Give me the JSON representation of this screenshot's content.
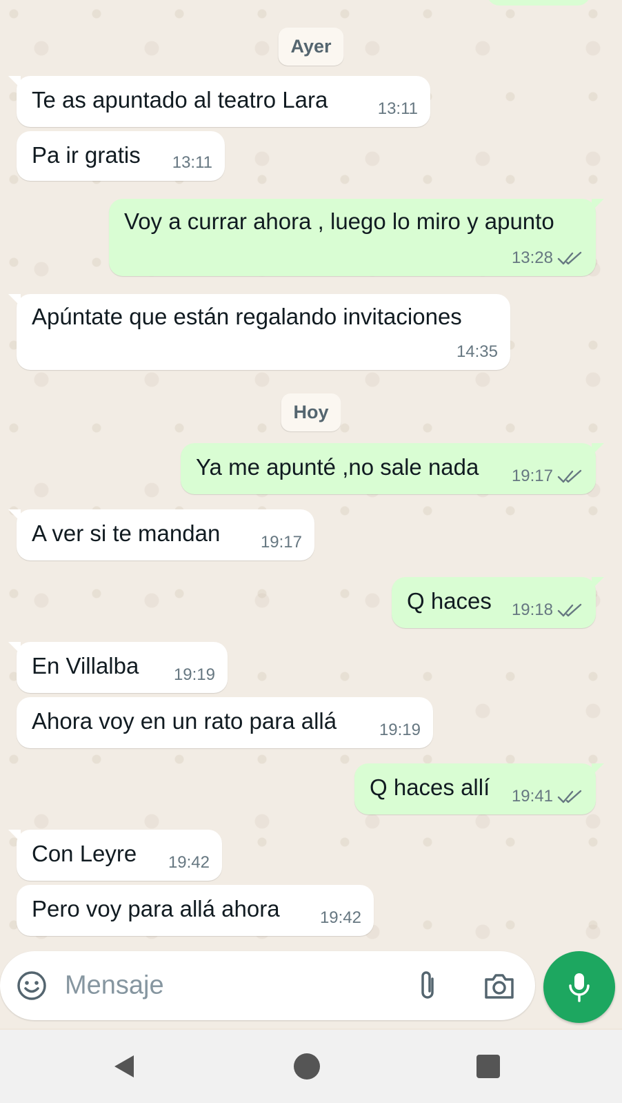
{
  "date_separators": [
    "Ayer",
    "Hoy"
  ],
  "messages": [
    {
      "dir": "in",
      "text": "Te as apuntado al teatro Lara",
      "time": "13:11"
    },
    {
      "dir": "in",
      "text": "Pa ir gratis",
      "time": "13:11"
    },
    {
      "dir": "out",
      "text": "Voy a currar ahora , luego lo miro y apunto",
      "time": "13:28",
      "status": "read"
    },
    {
      "dir": "in",
      "text": "Apúntate que están regalando invitaciones",
      "time": "14:35"
    },
    {
      "dir": "out",
      "text": "Ya me apunté ,no sale nada",
      "time": "19:17",
      "status": "read"
    },
    {
      "dir": "in",
      "text": "A ver si te mandan",
      "time": "19:17"
    },
    {
      "dir": "out",
      "text": "Q haces",
      "time": "19:18",
      "status": "read"
    },
    {
      "dir": "in",
      "text": "En Villalba",
      "time": "19:19"
    },
    {
      "dir": "in",
      "text": "Ahora voy en un rato para allá",
      "time": "19:19"
    },
    {
      "dir": "out",
      "text": "Q haces allí",
      "time": "19:41",
      "status": "read"
    },
    {
      "dir": "in",
      "text": "Con Leyre",
      "time": "19:42"
    },
    {
      "dir": "in",
      "text": "Pero voy para allá ahora",
      "time": "19:42"
    }
  ],
  "composer": {
    "placeholder": "Mensaje",
    "icons": [
      "emoji-icon",
      "attach-icon",
      "camera-icon"
    ],
    "send_icon": "mic-icon"
  },
  "navbar": {
    "icons": [
      "back-icon",
      "home-icon",
      "recents-icon"
    ]
  },
  "colors": {
    "incoming": "#ffffff",
    "outgoing": "#d9fdd3",
    "accent": "#1da760",
    "read_ticks": "#667781"
  }
}
